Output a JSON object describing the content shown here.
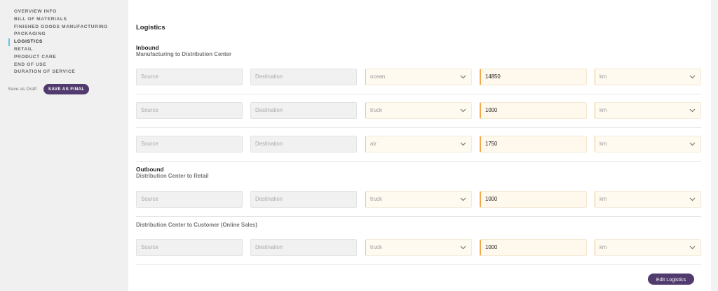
{
  "sidebar": {
    "items": [
      {
        "label": "OVERVIEW INFO",
        "active": false
      },
      {
        "label": "BILL OF MATERIALS",
        "active": false
      },
      {
        "label": "FINISHED GOODS MANUFACTURING",
        "active": false
      },
      {
        "label": "PACKAGING",
        "active": false
      },
      {
        "label": "LOGISTICS",
        "active": true
      },
      {
        "label": "RETAIL",
        "active": false
      },
      {
        "label": "PRODUCT CARE",
        "active": false
      },
      {
        "label": "END OF USE",
        "active": false
      },
      {
        "label": "DURATION OF SERVICE",
        "active": false
      }
    ],
    "save_draft_label": "Save as Draft",
    "save_final_label": "SAVE AS FINAL"
  },
  "main": {
    "title": "Logistics",
    "inbound": {
      "title": "Inbound",
      "subtitle": "Manufacturing to Distribution Center",
      "rows": [
        {
          "source_placeholder": "Source",
          "destination_placeholder": "Destination",
          "mode": "ocean",
          "distance": "14850",
          "unit": "km"
        },
        {
          "source_placeholder": "Source",
          "destination_placeholder": "Destination",
          "mode": "truck",
          "distance": "1000",
          "unit": "km"
        },
        {
          "source_placeholder": "Source",
          "destination_placeholder": "Destination",
          "mode": "air",
          "distance": "1750",
          "unit": "km"
        }
      ]
    },
    "outbound": {
      "title": "Outbound",
      "subtitle": "Distribution Center to Retail",
      "rows": [
        {
          "source_placeholder": "Source",
          "destination_placeholder": "Destination",
          "mode": "truck",
          "distance": "1000",
          "unit": "km"
        }
      ]
    },
    "online": {
      "subtitle": "Distribution Center to Customer (Online Sales)",
      "rows": [
        {
          "source_placeholder": "Source",
          "destination_placeholder": "Destination",
          "mode": "truck",
          "distance": "1000",
          "unit": "km"
        }
      ]
    },
    "edit_button_label": "Edit Logistics"
  },
  "colors": {
    "accent_purple": "#503a6e",
    "active_nav_indicator": "#5cc8e8",
    "required_field_border": "#f0a94a",
    "required_field_bg": "#fffaf0"
  },
  "icons": {
    "select_chevron": "chevron-down-icon"
  }
}
